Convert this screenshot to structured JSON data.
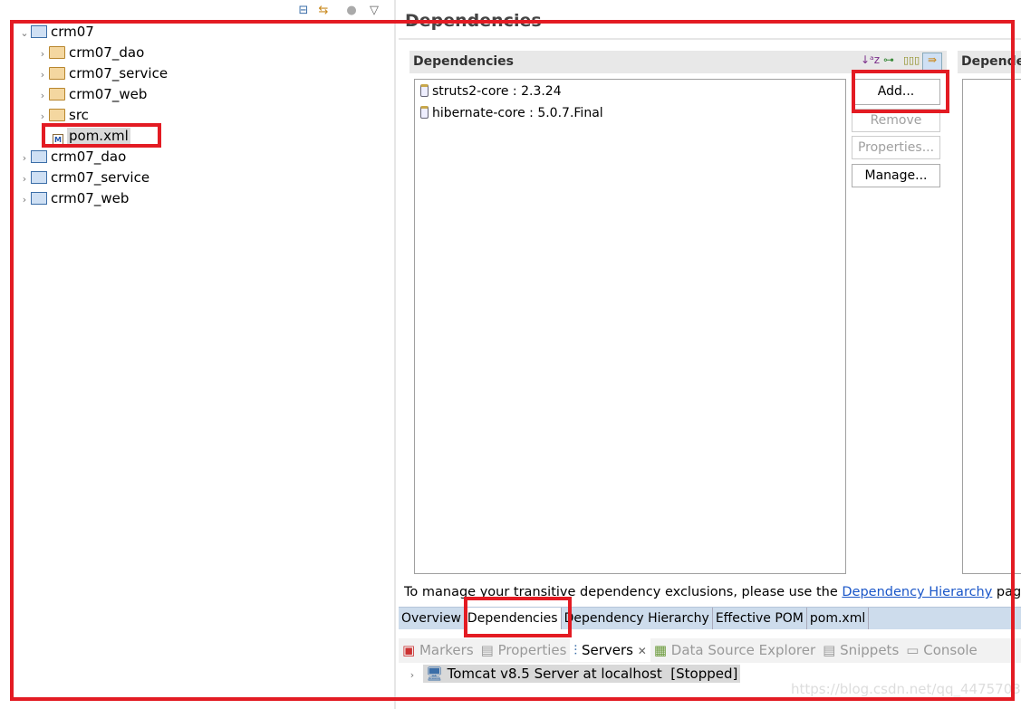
{
  "explorer": {
    "tree": [
      {
        "label": "crm07",
        "level": 0,
        "expanded": true,
        "icon": "maven-project-icon"
      },
      {
        "label": "crm07_dao",
        "level": 1,
        "icon": "folder-icon"
      },
      {
        "label": "crm07_service",
        "level": 1,
        "icon": "folder-icon"
      },
      {
        "label": "crm07_web",
        "level": 1,
        "icon": "folder-icon"
      },
      {
        "label": "src",
        "level": 1,
        "icon": "folder-icon"
      },
      {
        "label": "pom.xml",
        "level": 1,
        "icon": "pom-file-icon",
        "selected": true
      },
      {
        "label": "crm07_dao",
        "level": 0,
        "icon": "maven-project-warning-icon"
      },
      {
        "label": "crm07_service",
        "level": 0,
        "icon": "maven-project-warning-icon"
      },
      {
        "label": "crm07_web",
        "level": 0,
        "icon": "maven-project-warning-icon"
      }
    ]
  },
  "editor": {
    "page_title": "Dependencies",
    "section_title": "Dependencies",
    "right_section_title": "Depende",
    "dependencies": [
      "struts2-core : 2.3.24",
      "hibernate-core : 5.0.7.Final"
    ],
    "buttons": {
      "add": "Add...",
      "remove": "Remove",
      "properties": "Properties...",
      "manage": "Manage..."
    },
    "hint_text": "To manage your transitive dependency exclusions, please use the ",
    "hint_link": "Dependency Hierarchy",
    "hint_suffix": " pag",
    "tabs": [
      "Overview",
      "Dependencies",
      "Dependency Hierarchy",
      "Effective POM",
      "pom.xml"
    ],
    "active_tab": "Dependencies"
  },
  "views": {
    "tabs": [
      "Markers",
      "Properties",
      "Servers",
      "Data Source Explorer",
      "Snippets",
      "Console"
    ],
    "active_tab": "Servers",
    "server": "Tomcat v8.5 Server at localhost  [Stopped]"
  },
  "watermark": "https://blog.csdn.net/qq_44757034",
  "colors": {
    "highlight": "#e31b23",
    "link": "#1a56c8"
  }
}
